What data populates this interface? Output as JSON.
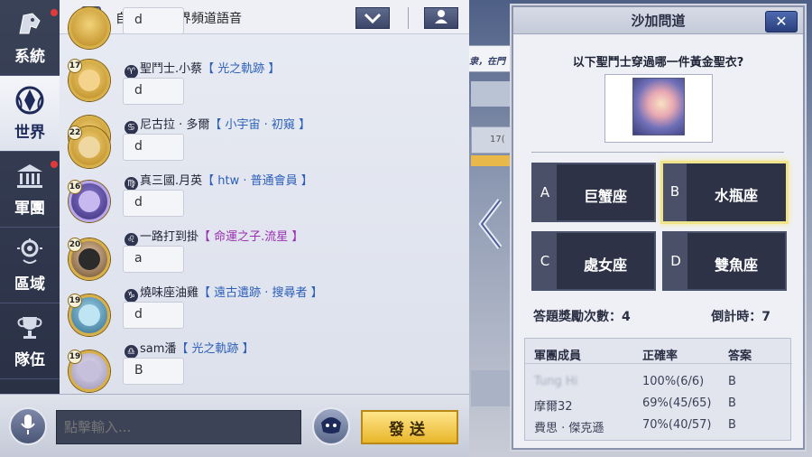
{
  "nav": {
    "items": [
      {
        "label": "系統",
        "icon": "helmet-icon",
        "dot": true
      },
      {
        "label": "世界",
        "icon": "world-emblem-icon",
        "dot": false,
        "active": true
      },
      {
        "label": "軍團",
        "icon": "temple-icon",
        "dot": true
      },
      {
        "label": "區域",
        "icon": "location-pin-icon",
        "dot": false
      },
      {
        "label": "隊伍",
        "icon": "trophy-icon",
        "dot": false
      }
    ]
  },
  "chat_header": {
    "autoplay_label": "自動播放世界頻道語音"
  },
  "background": {
    "strip_text": "隶，在門",
    "stat_text": "17("
  },
  "messages": [
    {
      "level": "17",
      "zodiac": "♈",
      "name": "聖鬥士.小蔡",
      "guild": "【 光之軌跡 】",
      "text": "d"
    },
    {
      "level": "",
      "zodiac": "♋",
      "name": "尼古拉 · 多爾",
      "guild": "【 小宇宙 · 初窺 】",
      "text": "d"
    },
    {
      "level": "22",
      "zodiac": "♍",
      "name": "真三國.月英",
      "guild": "【 htw · 普通會員 】",
      "text": "d"
    },
    {
      "level": "16",
      "zodiac": "♌",
      "name": "一路打到掛",
      "guild": "【 命運之子.流星 】",
      "text": "d"
    },
    {
      "level": "20",
      "zodiac": "♑",
      "name": "燒味座油雞",
      "guild": "【 遠古遺跡 · 搜尋者 】",
      "text": "a"
    },
    {
      "level": "19",
      "zodiac": "♎",
      "name": "sam潘",
      "guild": "【 光之軌跡 】",
      "text": "d"
    },
    {
      "level": "19",
      "zodiac": "",
      "name": "",
      "guild": "",
      "text": "B"
    }
  ],
  "input": {
    "placeholder": "點擊輸入...",
    "send_label": "發送"
  },
  "quiz": {
    "title": "沙加問道",
    "close": "✕",
    "question": "以下聖鬥士穿過哪一件黃金聖衣?",
    "options": [
      {
        "letter": "A",
        "text": "巨蟹座",
        "selected": false
      },
      {
        "letter": "B",
        "text": "水瓶座",
        "selected": true
      },
      {
        "letter": "C",
        "text": "處女座",
        "selected": false
      },
      {
        "letter": "D",
        "text": "雙魚座",
        "selected": false
      }
    ],
    "reward_label": "答題獎勵次數：",
    "reward_value": "4",
    "timer_label": "倒計時：",
    "timer_value": "7",
    "table": {
      "headers": [
        "軍團成員",
        "正確率",
        "答案"
      ],
      "rows": [
        {
          "member": "Tung Hi",
          "rate": "100%(6/6)",
          "answer": "B",
          "blurred": true
        },
        {
          "member": "摩爾32",
          "rate": "69%(45/65)",
          "answer": "B",
          "blurred": false
        },
        {
          "member": "費思 · 傑克遜",
          "rate": "70%(40/57)",
          "answer": "B",
          "blurred": false
        }
      ]
    }
  }
}
